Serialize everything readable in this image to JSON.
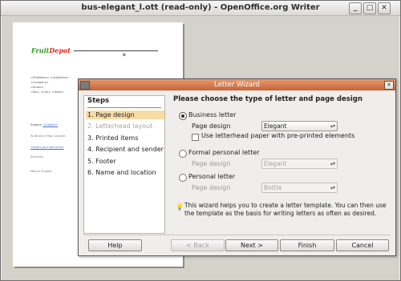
{
  "window": {
    "title": "bus-elegant_l.ott (read-only) - OpenOffice.org Writer"
  },
  "document": {
    "logo_part1": "Fruit",
    "logo_part2": "Depot",
    "address_lines": [
      "<FirstName> <LastName>",
      "<Company>",
      "<Street>",
      "<Zip> <City> <State>"
    ],
    "subject": "Subject:",
    "salutation": "To Whom it May Concern:",
    "closing": "Sincerely",
    "signature": "Marvin Chapter"
  },
  "dialog": {
    "title": "Letter Wizard",
    "steps_title": "Steps",
    "steps": [
      {
        "label": "1. Page design",
        "state": "active"
      },
      {
        "label": "2. Letterhead layout",
        "state": "disabled"
      },
      {
        "label": "3. Printed items",
        "state": "normal"
      },
      {
        "label": "4. Recipient and sender",
        "state": "normal"
      },
      {
        "label": "5. Footer",
        "state": "normal"
      },
      {
        "label": "6. Name and location",
        "state": "normal"
      }
    ],
    "heading": "Please choose the type of letter and page design",
    "business": {
      "label": "Business letter",
      "selected": true,
      "page_design_label": "Page design",
      "page_design_value": "Elegant",
      "letterhead_checkbox": "Use letterhead paper with pre-printed elements",
      "letterhead_checked": false
    },
    "formal": {
      "label": "Formal personal letter",
      "selected": false,
      "page_design_label": "Page design",
      "page_design_value": "Elegant"
    },
    "personal": {
      "label": "Personal letter",
      "selected": false,
      "page_design_label": "Page design",
      "page_design_value": "Bottle"
    },
    "info_text": "This wizard helps you to create a letter template. You can then use the template as the basis for writing letters as often as desired.",
    "buttons": {
      "help": "Help",
      "back": "< Back",
      "next": "Next >",
      "finish": "Finish",
      "cancel": "Cancel"
    }
  }
}
